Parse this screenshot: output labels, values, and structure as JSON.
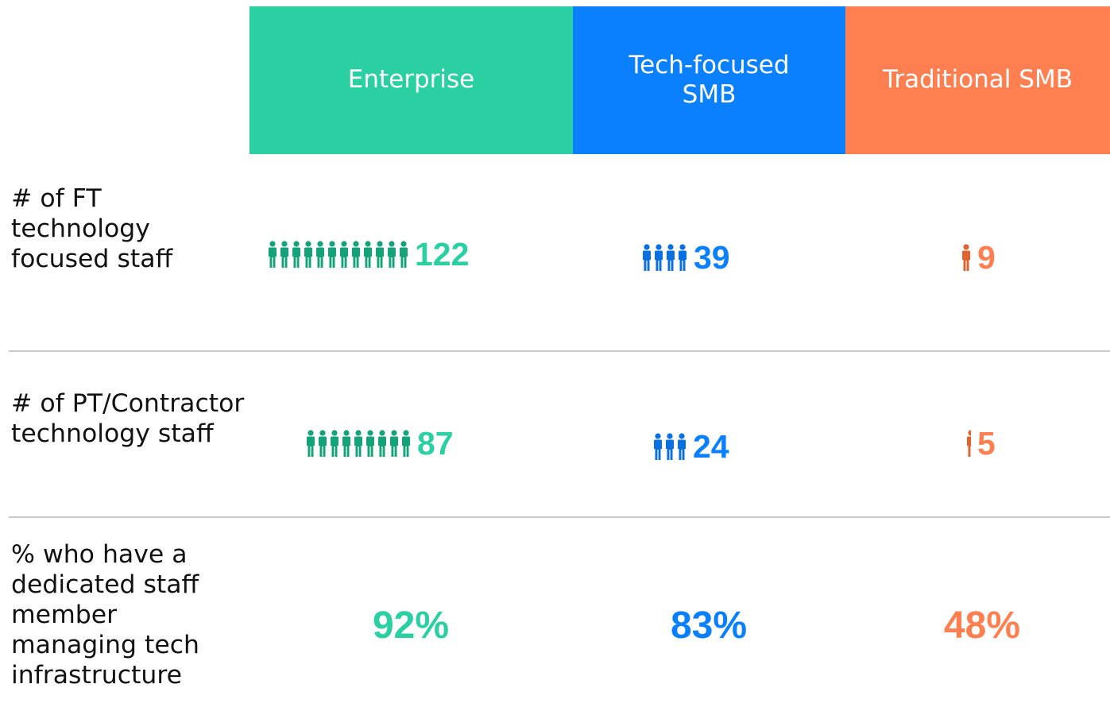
{
  "chart_data": {
    "type": "table",
    "columns": [
      {
        "key": "enterprise",
        "label": "Enterprise",
        "color": "#2ACFA2",
        "icon_color": "#13A27A"
      },
      {
        "key": "techsmb",
        "label": "Tech-focused SMB",
        "color": "#0A80FF",
        "icon_color": "#0A6FE0"
      },
      {
        "key": "tradsmb",
        "label": "Traditional SMB",
        "color": "#FF7F50",
        "icon_color": "#E2622F"
      }
    ],
    "rows": [
      {
        "label": "# of FT technology focused staff",
        "values": [
          122,
          39,
          9
        ],
        "display": [
          "122",
          "39",
          "9"
        ],
        "icon_counts": [
          12,
          4,
          1
        ]
      },
      {
        "label": "# of PT/Contractor technology staff",
        "values": [
          87,
          24,
          5
        ],
        "display": [
          "87",
          "24",
          "5"
        ],
        "icon_counts": [
          9,
          3,
          0.5
        ]
      },
      {
        "label": "% who have a dedicated staff member managing tech infrastructure",
        "values": [
          92,
          83,
          48
        ],
        "display": [
          "92%",
          "83%",
          "48%"
        ]
      }
    ]
  }
}
